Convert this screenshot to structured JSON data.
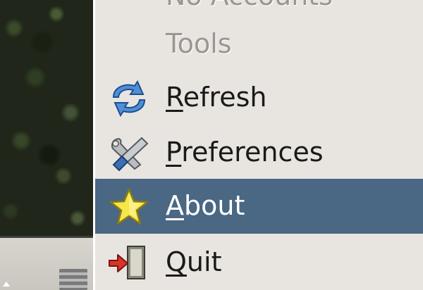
{
  "menu": {
    "items": [
      {
        "label": "No Accounts",
        "mnemonic": "",
        "rest": "No Accounts",
        "enabled": false,
        "icon": ""
      },
      {
        "label": "Tools",
        "mnemonic": "",
        "rest": "Tools",
        "enabled": false,
        "icon": ""
      },
      {
        "label": "Refresh",
        "mnemonic": "R",
        "rest": "efresh",
        "enabled": true,
        "icon": "refresh-icon"
      },
      {
        "label": "Preferences",
        "mnemonic": "P",
        "rest": "references",
        "enabled": true,
        "icon": "tools-icon"
      },
      {
        "label": "About",
        "mnemonic": "A",
        "rest": "bout",
        "enabled": true,
        "selected": true,
        "icon": "star-icon"
      },
      {
        "label": "Quit",
        "mnemonic": "Q",
        "rest": "uit",
        "enabled": true,
        "icon": "exit-door-icon"
      }
    ]
  },
  "colors": {
    "menu_background": "#e8e5e1",
    "selection": "#4a6784",
    "disabled_text": "#9a9792"
  }
}
